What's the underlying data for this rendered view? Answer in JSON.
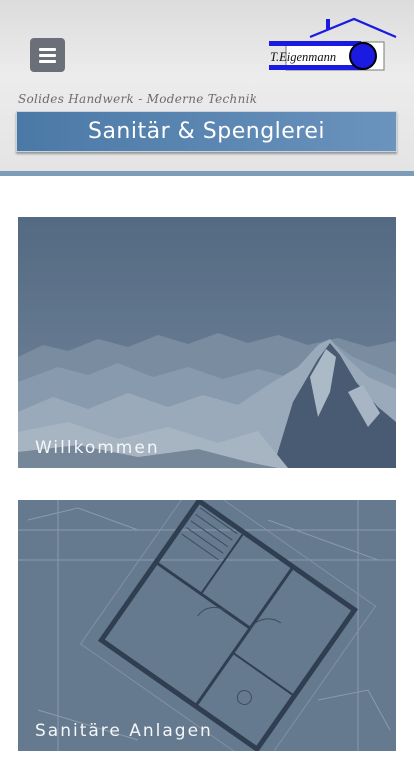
{
  "header": {
    "menu_icon": "hamburger-menu-icon",
    "logo_text": "T.Eigenmann",
    "tagline": "Solides Handwerk - Moderne Technik",
    "title": "Sanitär & Spenglerei",
    "accent_color": "#4b79a6",
    "border_color": "#7d9cba"
  },
  "cards": [
    {
      "label": "Willkommen",
      "image": "mountain-landscape"
    },
    {
      "label": "Sanitäre Anlagen",
      "image": "floor-plan-blueprint"
    }
  ]
}
